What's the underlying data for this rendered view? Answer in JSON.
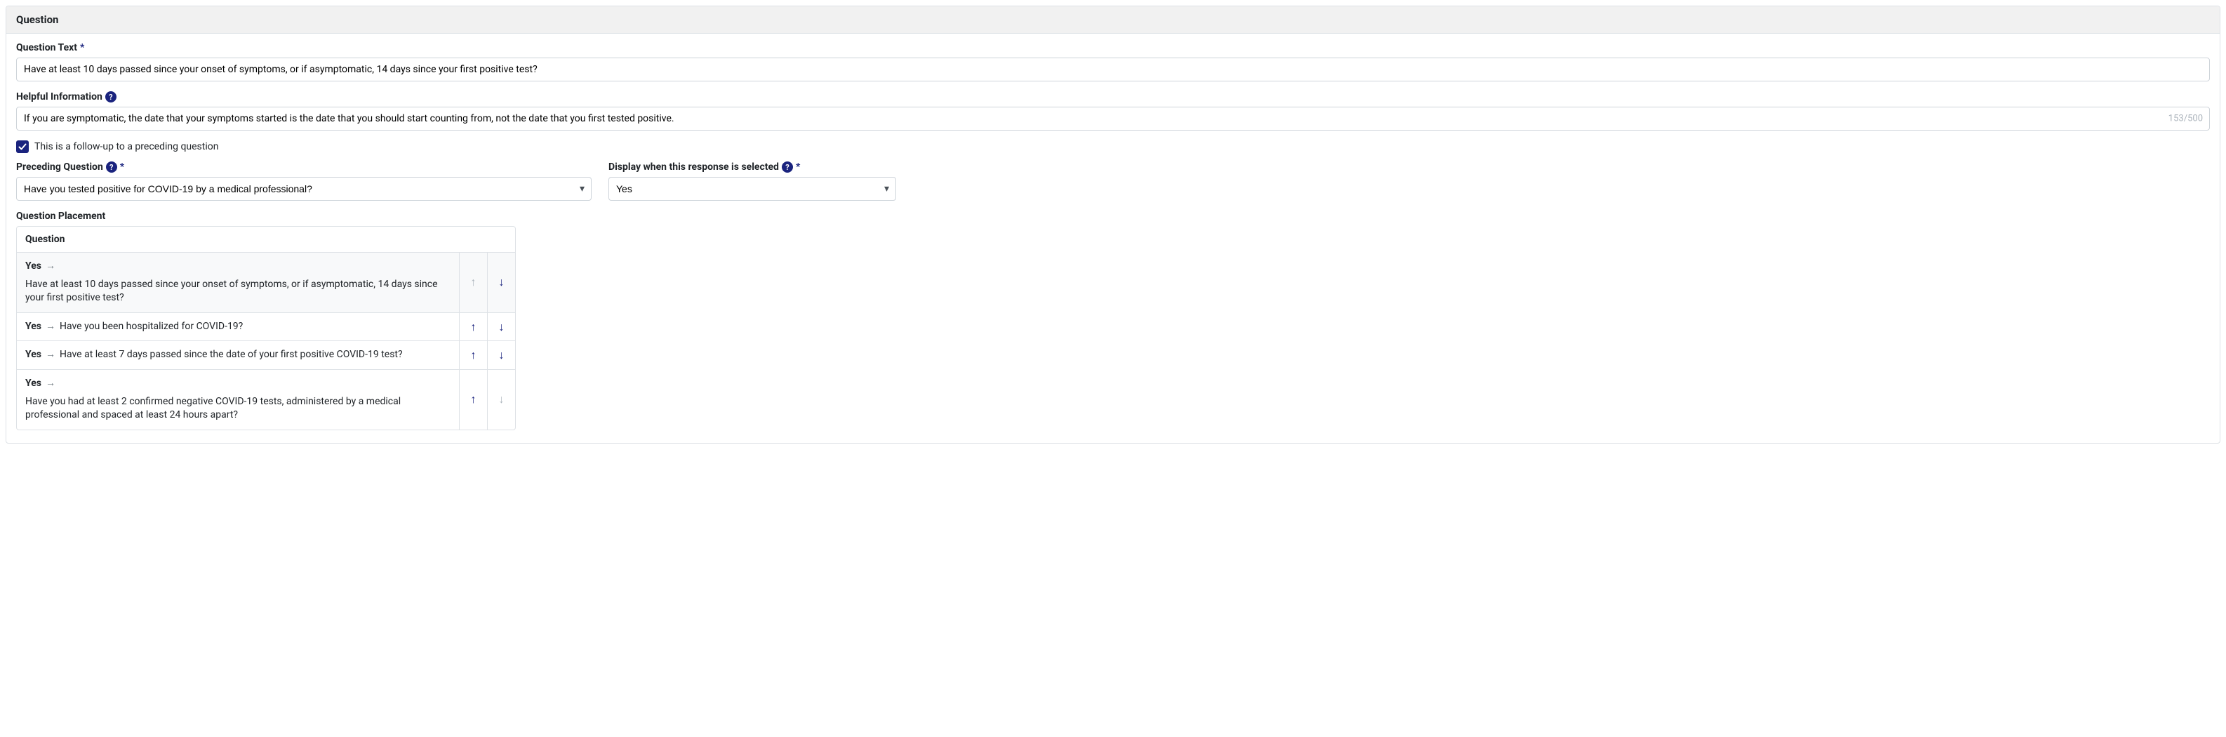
{
  "panel": {
    "title": "Question"
  },
  "questionText": {
    "label": "Question Text",
    "required": "*",
    "value": "Have at least 10 days passed since your onset of symptoms, or if asymptomatic, 14 days since your first positive test?"
  },
  "helpfulInfo": {
    "label": "Helpful Information",
    "value": "If you are symptomatic, the date that your symptoms started is the date that you should start counting from, not the date that you first tested positive.",
    "charCount": "153/500"
  },
  "followUp": {
    "checkboxLabel": "This is a follow-up to a preceding question"
  },
  "preceding": {
    "label": "Preceding Question",
    "required": "*",
    "value": "Have you tested positive for COVID-19 by a medical professional?"
  },
  "displayWhen": {
    "label": "Display when this response is selected",
    "required": "*",
    "value": "Yes"
  },
  "placement": {
    "label": "Question Placement",
    "columnHeader": "Question",
    "rows": [
      {
        "answer": "Yes",
        "text": "Have at least 10 days passed since your onset of symptoms, or if asymptomatic, 14 days since your first positive test?",
        "upDisabled": true,
        "downDisabled": false,
        "selected": true
      },
      {
        "answer": "Yes",
        "text": "Have you been hospitalized for COVID-19?",
        "upDisabled": false,
        "downDisabled": false,
        "selected": false
      },
      {
        "answer": "Yes",
        "text": "Have at least 7 days passed since the date of your first positive COVID-19 test?",
        "upDisabled": false,
        "downDisabled": false,
        "selected": false
      },
      {
        "answer": "Yes",
        "text": "Have you had at least 2 confirmed negative COVID-19 tests, administered by a medical professional and spaced at least 24 hours apart?",
        "upDisabled": false,
        "downDisabled": true,
        "selected": false
      }
    ]
  },
  "glyphs": {
    "arrow": "→",
    "up": "↑",
    "down": "↓",
    "help": "?",
    "check": "✓",
    "caret": "▾"
  }
}
